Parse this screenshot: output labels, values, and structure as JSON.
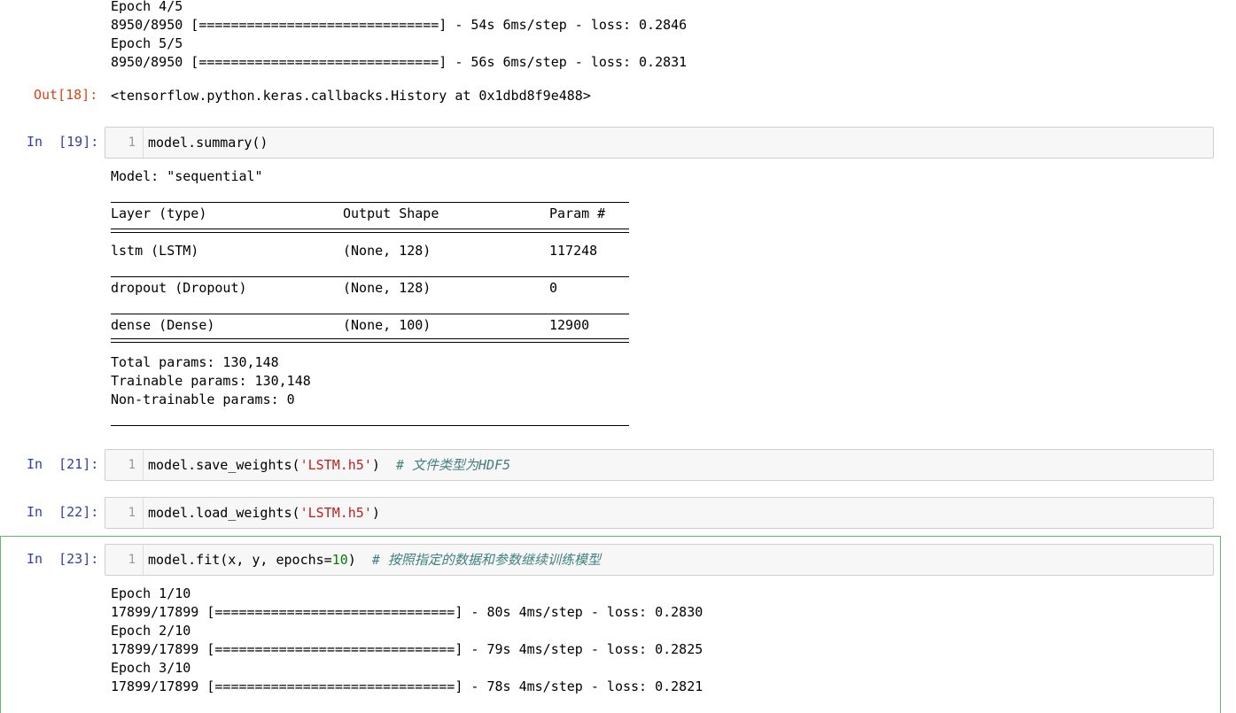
{
  "top_output": [
    "Epoch 4/5",
    "8950/8950 [==============================] - 54s 6ms/step - loss: 0.2846",
    "Epoch 5/5",
    "8950/8950 [==============================] - 56s 6ms/step - loss: 0.2831"
  ],
  "cell18": {
    "out_prompt": "Out[18]:",
    "result": "<tensorflow.python.keras.callbacks.History at 0x1dbd8f9e488>"
  },
  "cell19": {
    "in_prompt": "In  [19]:",
    "line_no": "1",
    "code": "model.summary()",
    "model_title": "Model: \"sequential\"",
    "headers": {
      "layer": "Layer (type)",
      "shape": "Output Shape",
      "param": "Param #"
    },
    "rows": [
      {
        "layer": "lstm (LSTM)",
        "shape": "(None, 128)",
        "param": "117248"
      },
      {
        "layer": "dropout (Dropout)",
        "shape": "(None, 128)",
        "param": "0"
      },
      {
        "layer": "dense (Dense)",
        "shape": "(None, 100)",
        "param": "12900"
      }
    ],
    "totals": [
      "Total params: 130,148",
      "Trainable params: 130,148",
      "Non-trainable params: 0"
    ]
  },
  "cell21": {
    "in_prompt": "In  [21]:",
    "line_no": "1",
    "code_pre": "model.save_weights(",
    "code_str": "'LSTM.h5'",
    "code_post": ")  ",
    "comment": "# 文件类型为HDF5"
  },
  "cell22": {
    "in_prompt": "In  [22]:",
    "line_no": "1",
    "code_pre": "model.load_weights(",
    "code_str": "'LSTM.h5'",
    "code_post": ")"
  },
  "cell23": {
    "in_prompt": "In  [23]:",
    "line_no": "1",
    "code_pre": "model.fit(x, y, epochs=",
    "code_num": "10",
    "code_post": ")  ",
    "comment": "# 按照指定的数据和参数继续训练模型",
    "output": [
      "Epoch 1/10",
      "17899/17899 [==============================] - 80s 4ms/step - loss: 0.2830",
      "Epoch 2/10",
      "17899/17899 [==============================] - 79s 4ms/step - loss: 0.2825",
      "Epoch 3/10",
      "17899/17899 [==============================] - 78s 4ms/step - loss: 0.2821"
    ]
  },
  "colors": {
    "in_prompt": "#303f9f",
    "out_prompt": "#d84315",
    "string": "#ba2121",
    "number": "#008000",
    "comment": "#408080",
    "selected_border": "#66bb6a"
  }
}
